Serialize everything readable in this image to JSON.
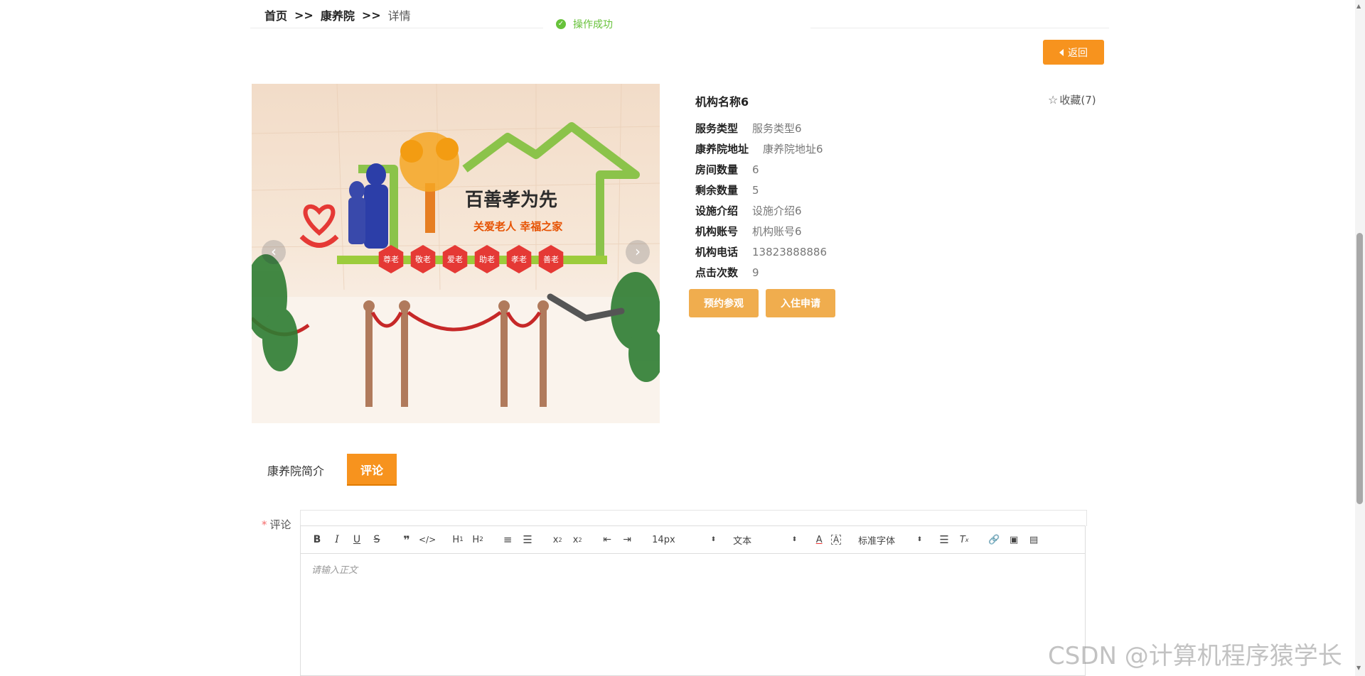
{
  "breadcrumb": {
    "home": "首页",
    "sep1": ">>",
    "section": "康养院",
    "sep2": ">>",
    "current": "详情"
  },
  "toast": {
    "message": "操作成功",
    "icon": "check-circle-icon"
  },
  "back_button": {
    "label": "返回",
    "icon": "caret-left-icon"
  },
  "carousel": {
    "image_text": {
      "slogan": "百善孝为先",
      "subtitle": "关爱老人 幸福之家",
      "badges": [
        "尊老",
        "敬老",
        "爱老",
        "助老",
        "孝老",
        "善老"
      ]
    },
    "prev_icon": "‹",
    "next_icon": "›"
  },
  "institution": {
    "name": "机构名称6",
    "favorite": {
      "label": "收藏(7)",
      "icon": "star-outline-icon"
    },
    "fields": [
      {
        "key": "服务类型",
        "value": "服务类型6"
      },
      {
        "key": "康养院地址",
        "value": "康养院地址6"
      },
      {
        "key": "房间数量",
        "value": "6"
      },
      {
        "key": "剩余数量",
        "value": "5"
      },
      {
        "key": "设施介绍",
        "value": "设施介绍6"
      },
      {
        "key": "机构账号",
        "value": "机构账号6"
      },
      {
        "key": "机构电话",
        "value": "13823888886"
      },
      {
        "key": "点击次数",
        "value": "9"
      }
    ],
    "actions": {
      "reserve_visit": "预约参观",
      "apply_checkin": "入住申请"
    }
  },
  "tabs": {
    "intro": "康养院简介",
    "comments": "评论",
    "active": "comments"
  },
  "comment_form": {
    "required_mark": "*",
    "label": "评论",
    "toolbar": {
      "font_size": "14px",
      "header": "文本",
      "font_family": "标准字体"
    },
    "placeholder": "请输入正文"
  },
  "watermark": "CSDN @计算机程序猿学长",
  "colors": {
    "accent": "#f7931e",
    "button_secondary": "#f0ad4e",
    "success": "#67c23a"
  }
}
